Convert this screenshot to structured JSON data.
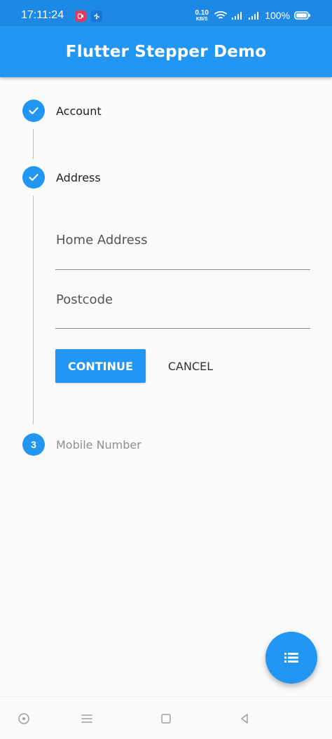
{
  "status_bar": {
    "time": "17:11:24",
    "network_speed_value": "0.10",
    "network_speed_unit": "KB/S",
    "battery_percent": "100%"
  },
  "app_bar": {
    "title": "Flutter Stepper Demo"
  },
  "stepper": {
    "steps": [
      {
        "title": "Account",
        "state": "complete",
        "icon": "check-icon"
      },
      {
        "title": "Address",
        "state": "complete",
        "icon": "check-icon",
        "fields": [
          {
            "label": "Home Address",
            "value": ""
          },
          {
            "label": "Postcode",
            "value": ""
          }
        ],
        "actions": {
          "continue": "CONTINUE",
          "cancel": "CANCEL"
        }
      },
      {
        "title": "Mobile Number",
        "state": "inactive",
        "number": "3"
      }
    ]
  },
  "fab": {
    "icon": "list-icon"
  },
  "navigation_bar": {
    "buttons": [
      {
        "icon": "target-icon"
      },
      {
        "icon": "menu-icon"
      },
      {
        "icon": "home-square-icon"
      },
      {
        "icon": "back-triangle-icon"
      }
    ]
  },
  "colors": {
    "primary": "#2196f3",
    "status_bar": "#1e88e5",
    "background": "#fafafa",
    "text_dark": "#1f1f1f",
    "text_muted": "#8f8f8f",
    "line": "#bdbdbd"
  }
}
